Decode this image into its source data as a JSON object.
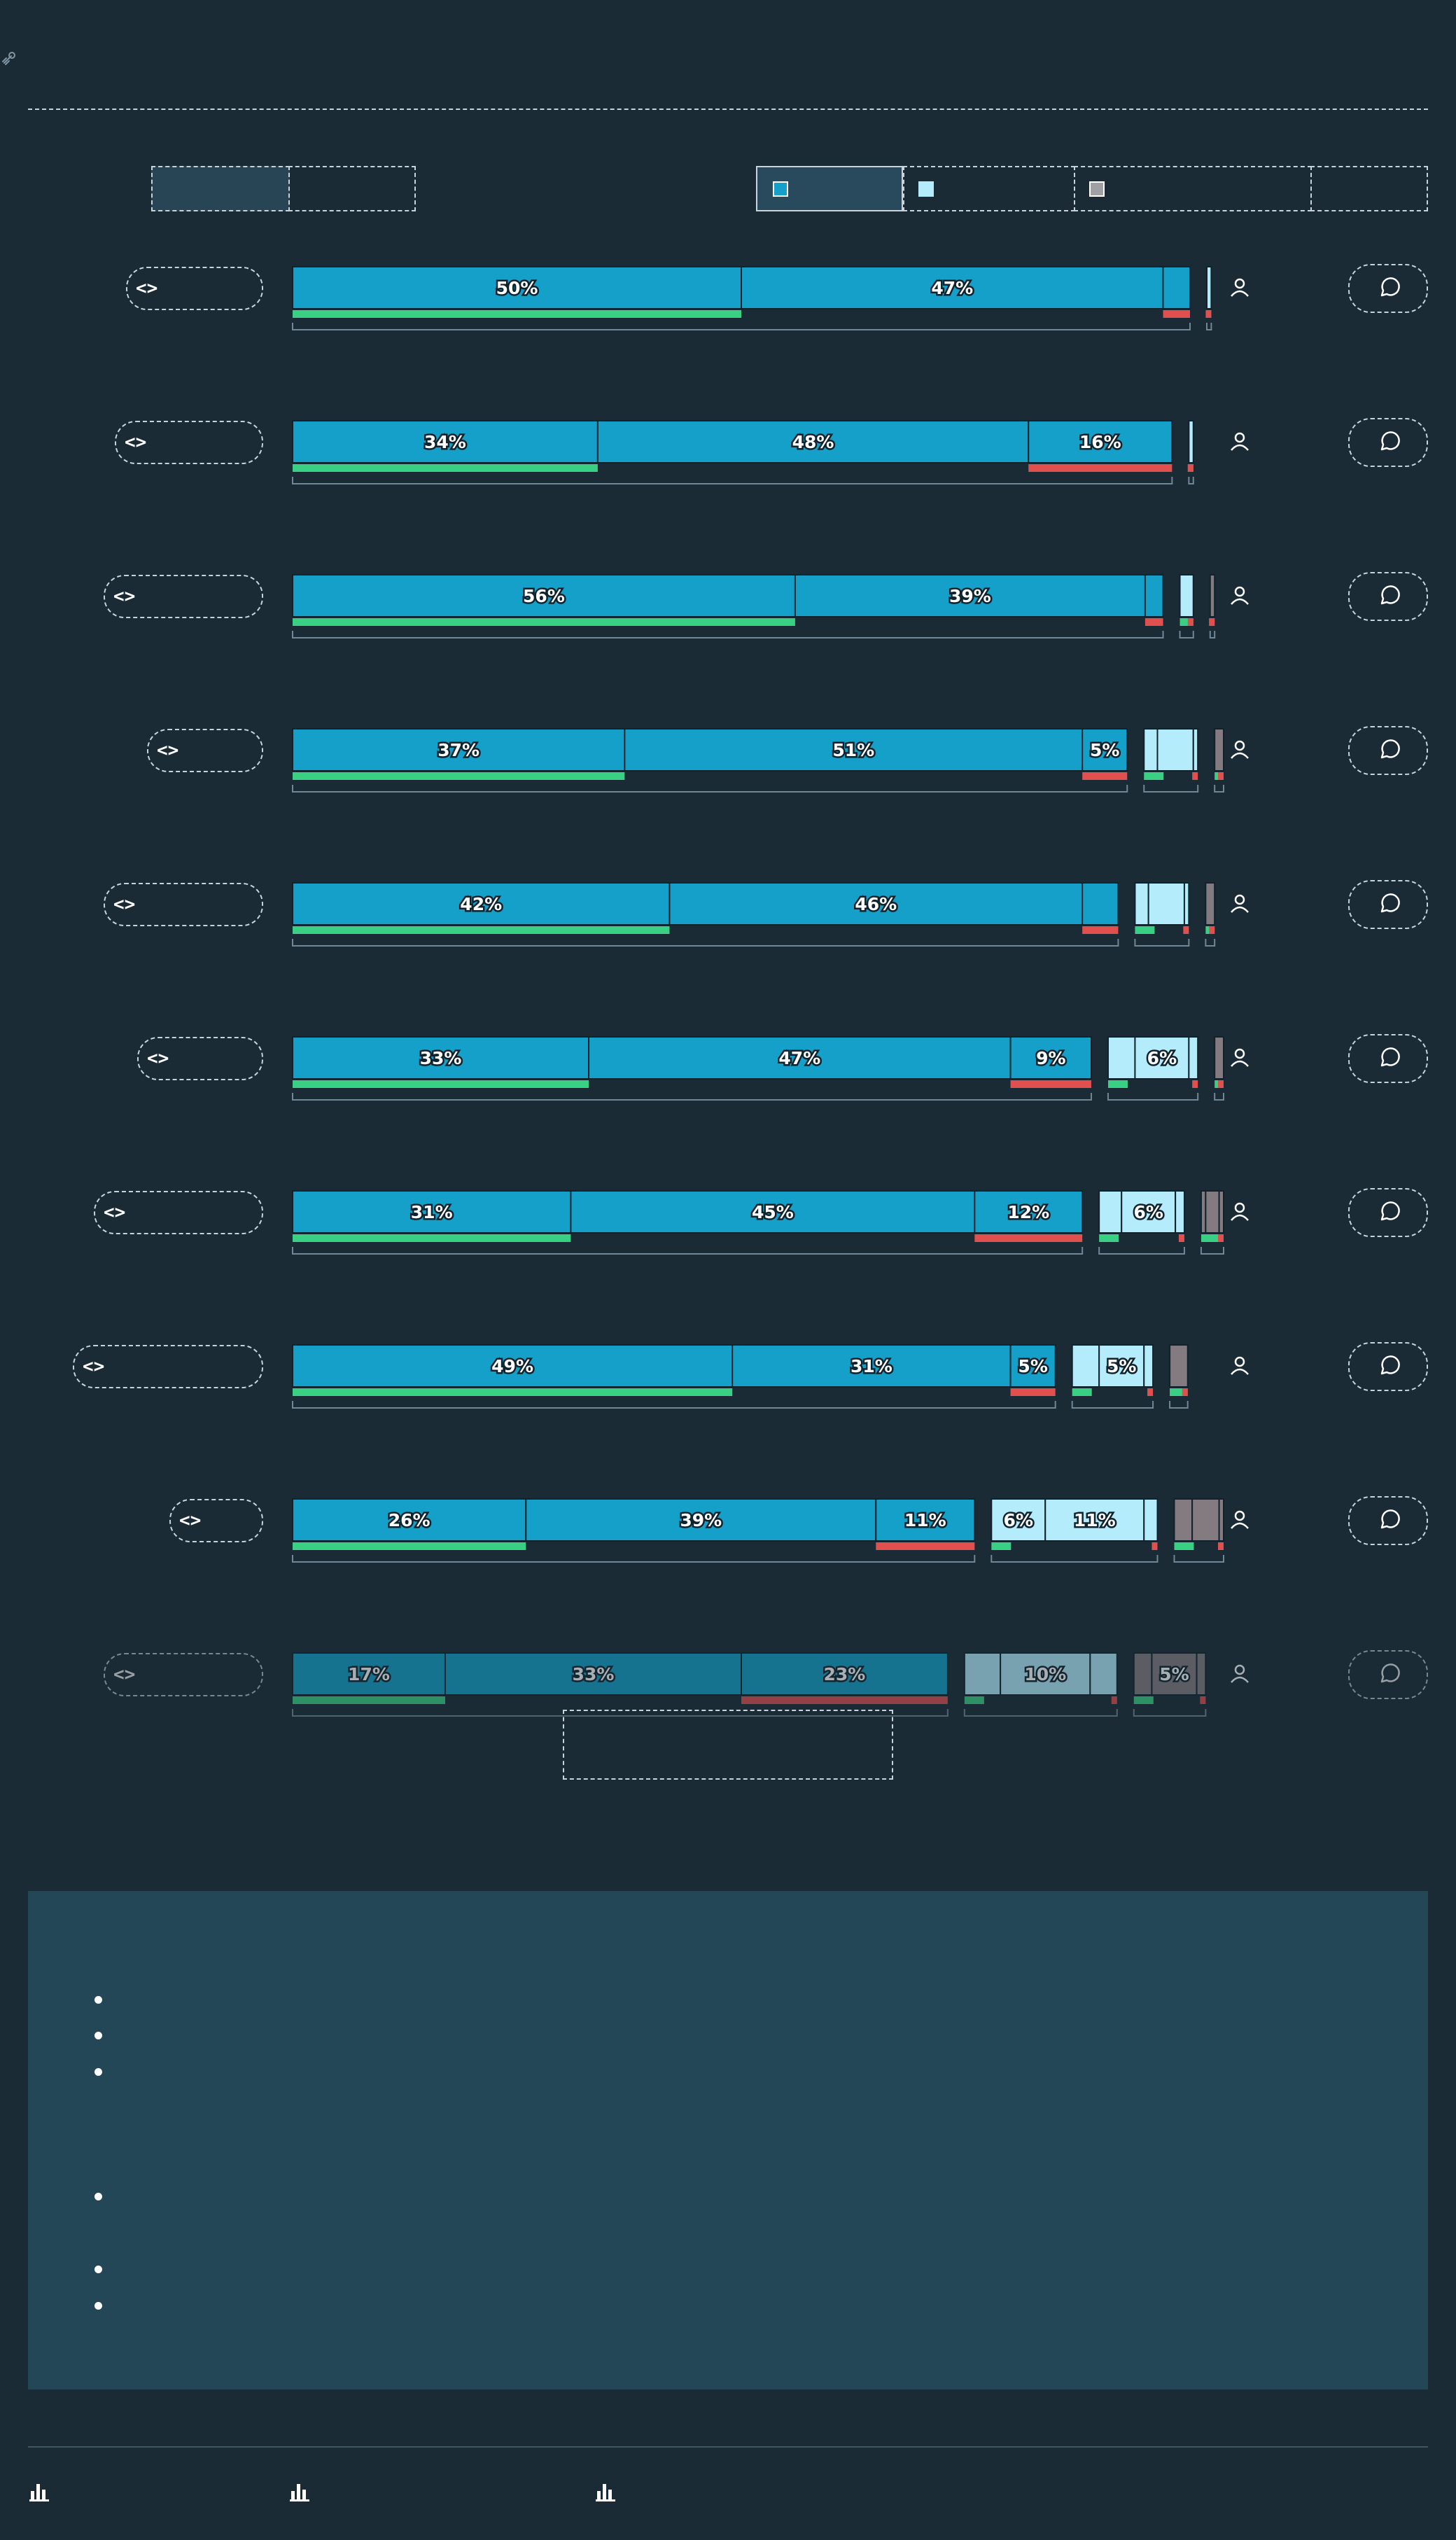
{
  "header": {
    "link_icon": "link-icon"
  },
  "toggle": {
    "segments": [
      "",
      ""
    ]
  },
  "legend": {
    "items": [
      {
        "label": "",
        "swatch": "#14a0c8"
      },
      {
        "label": "",
        "swatch": "#b4ecfc"
      },
      {
        "label": "",
        "swatch": "#a0a0a4"
      },
      {
        "label": ""
      }
    ]
  },
  "colors": {
    "background": "#1a2b36",
    "segment_primary": "#14a0c8",
    "segment_secondary": "#b4ecfc",
    "segment_tertiary": "#847b81",
    "positive": "#3ad083",
    "negative": "#e0504f",
    "panel": "#244758"
  },
  "icons": {
    "row_code": "code-icon",
    "row_user": "user-icon",
    "row_comment": "comment-icon",
    "footer": "bar-chart-icon"
  },
  "chart_data": {
    "type": "bar",
    "orientation": "horizontal",
    "stacked": true,
    "rows": [
      {
        "segments": [
          {
            "group": "primary",
            "value": 50,
            "label": "50%"
          },
          {
            "group": "primary",
            "value": 47,
            "label": "47%"
          },
          {
            "group": "primary",
            "value": 3
          },
          {
            "group": "secondary",
            "value": 0.5
          }
        ]
      },
      {
        "segments": [
          {
            "group": "primary",
            "value": 34,
            "label": "34%"
          },
          {
            "group": "primary",
            "value": 48,
            "label": "48%"
          },
          {
            "group": "primary",
            "value": 16,
            "label": "16%"
          },
          {
            "group": "secondary",
            "value": 0.5
          }
        ]
      },
      {
        "segments": [
          {
            "group": "primary",
            "value": 56,
            "label": "56%"
          },
          {
            "group": "primary",
            "value": 39,
            "label": "39%"
          },
          {
            "group": "primary",
            "value": 2
          },
          {
            "group": "secondary",
            "value": 1.5
          },
          {
            "group": "tertiary",
            "value": 0.5
          }
        ]
      },
      {
        "segments": [
          {
            "group": "primary",
            "value": 37,
            "label": "37%"
          },
          {
            "group": "primary",
            "value": 51,
            "label": "51%"
          },
          {
            "group": "primary",
            "value": 5,
            "label": "5%"
          },
          {
            "group": "secondary",
            "value": 1.5
          },
          {
            "group": "secondary",
            "value": 4
          },
          {
            "group": "secondary",
            "value": 0.5
          },
          {
            "group": "tertiary",
            "value": 1
          }
        ]
      },
      {
        "segments": [
          {
            "group": "primary",
            "value": 42,
            "label": "42%"
          },
          {
            "group": "primary",
            "value": 46,
            "label": "46%"
          },
          {
            "group": "primary",
            "value": 4
          },
          {
            "group": "secondary",
            "value": 1.5
          },
          {
            "group": "secondary",
            "value": 4
          },
          {
            "group": "secondary",
            "value": 0.5
          },
          {
            "group": "tertiary",
            "value": 1
          }
        ]
      },
      {
        "segments": [
          {
            "group": "primary",
            "value": 33,
            "label": "33%"
          },
          {
            "group": "primary",
            "value": 47,
            "label": "47%"
          },
          {
            "group": "primary",
            "value": 9,
            "label": "9%"
          },
          {
            "group": "secondary",
            "value": 3
          },
          {
            "group": "secondary",
            "value": 6,
            "label": "6%"
          },
          {
            "group": "secondary",
            "value": 1
          },
          {
            "group": "tertiary",
            "value": 1
          }
        ]
      },
      {
        "segments": [
          {
            "group": "primary",
            "value": 31,
            "label": "31%"
          },
          {
            "group": "primary",
            "value": 45,
            "label": "45%"
          },
          {
            "group": "primary",
            "value": 12,
            "label": "12%"
          },
          {
            "group": "secondary",
            "value": 2.5
          },
          {
            "group": "secondary",
            "value": 6,
            "label": "6%"
          },
          {
            "group": "secondary",
            "value": 1
          },
          {
            "group": "tertiary",
            "value": 0.5
          },
          {
            "group": "tertiary",
            "value": 1.5
          },
          {
            "group": "tertiary",
            "value": 0.5
          }
        ]
      },
      {
        "segments": [
          {
            "group": "primary",
            "value": 49,
            "label": "49%"
          },
          {
            "group": "primary",
            "value": 31,
            "label": "31%"
          },
          {
            "group": "primary",
            "value": 5,
            "label": "5%"
          },
          {
            "group": "secondary",
            "value": 3
          },
          {
            "group": "secondary",
            "value": 5,
            "label": "5%"
          },
          {
            "group": "secondary",
            "value": 1
          },
          {
            "group": "tertiary",
            "value": 2
          }
        ]
      },
      {
        "segments": [
          {
            "group": "primary",
            "value": 26,
            "label": "26%"
          },
          {
            "group": "primary",
            "value": 39,
            "label": "39%"
          },
          {
            "group": "primary",
            "value": 11,
            "label": "11%"
          },
          {
            "group": "secondary",
            "value": 6,
            "label": "6%"
          },
          {
            "group": "secondary",
            "value": 11,
            "label": "11%"
          },
          {
            "group": "secondary",
            "value": 1.5
          },
          {
            "group": "tertiary",
            "value": 2
          },
          {
            "group": "tertiary",
            "value": 3
          },
          {
            "group": "tertiary",
            "value": 0.5
          }
        ]
      },
      {
        "dimmed": true,
        "segments": [
          {
            "group": "primary",
            "value": 17,
            "label": "17%"
          },
          {
            "group": "primary",
            "value": 33,
            "label": "33%"
          },
          {
            "group": "primary",
            "value": 23,
            "label": "23%"
          },
          {
            "group": "secondary",
            "value": 4
          },
          {
            "group": "secondary",
            "value": 10,
            "label": "10%"
          },
          {
            "group": "secondary",
            "value": 3
          },
          {
            "group": "tertiary",
            "value": 2
          },
          {
            "group": "tertiary",
            "value": 5,
            "label": "5%"
          },
          {
            "group": "tertiary",
            "value": 1
          }
        ]
      }
    ]
  },
  "tooltip": {
    "text": ""
  },
  "notes": {
    "first_list": [
      "",
      "",
      ""
    ],
    "second_list": [
      "",
      "",
      ""
    ]
  },
  "footer": {
    "items": [
      "",
      "",
      ""
    ]
  }
}
